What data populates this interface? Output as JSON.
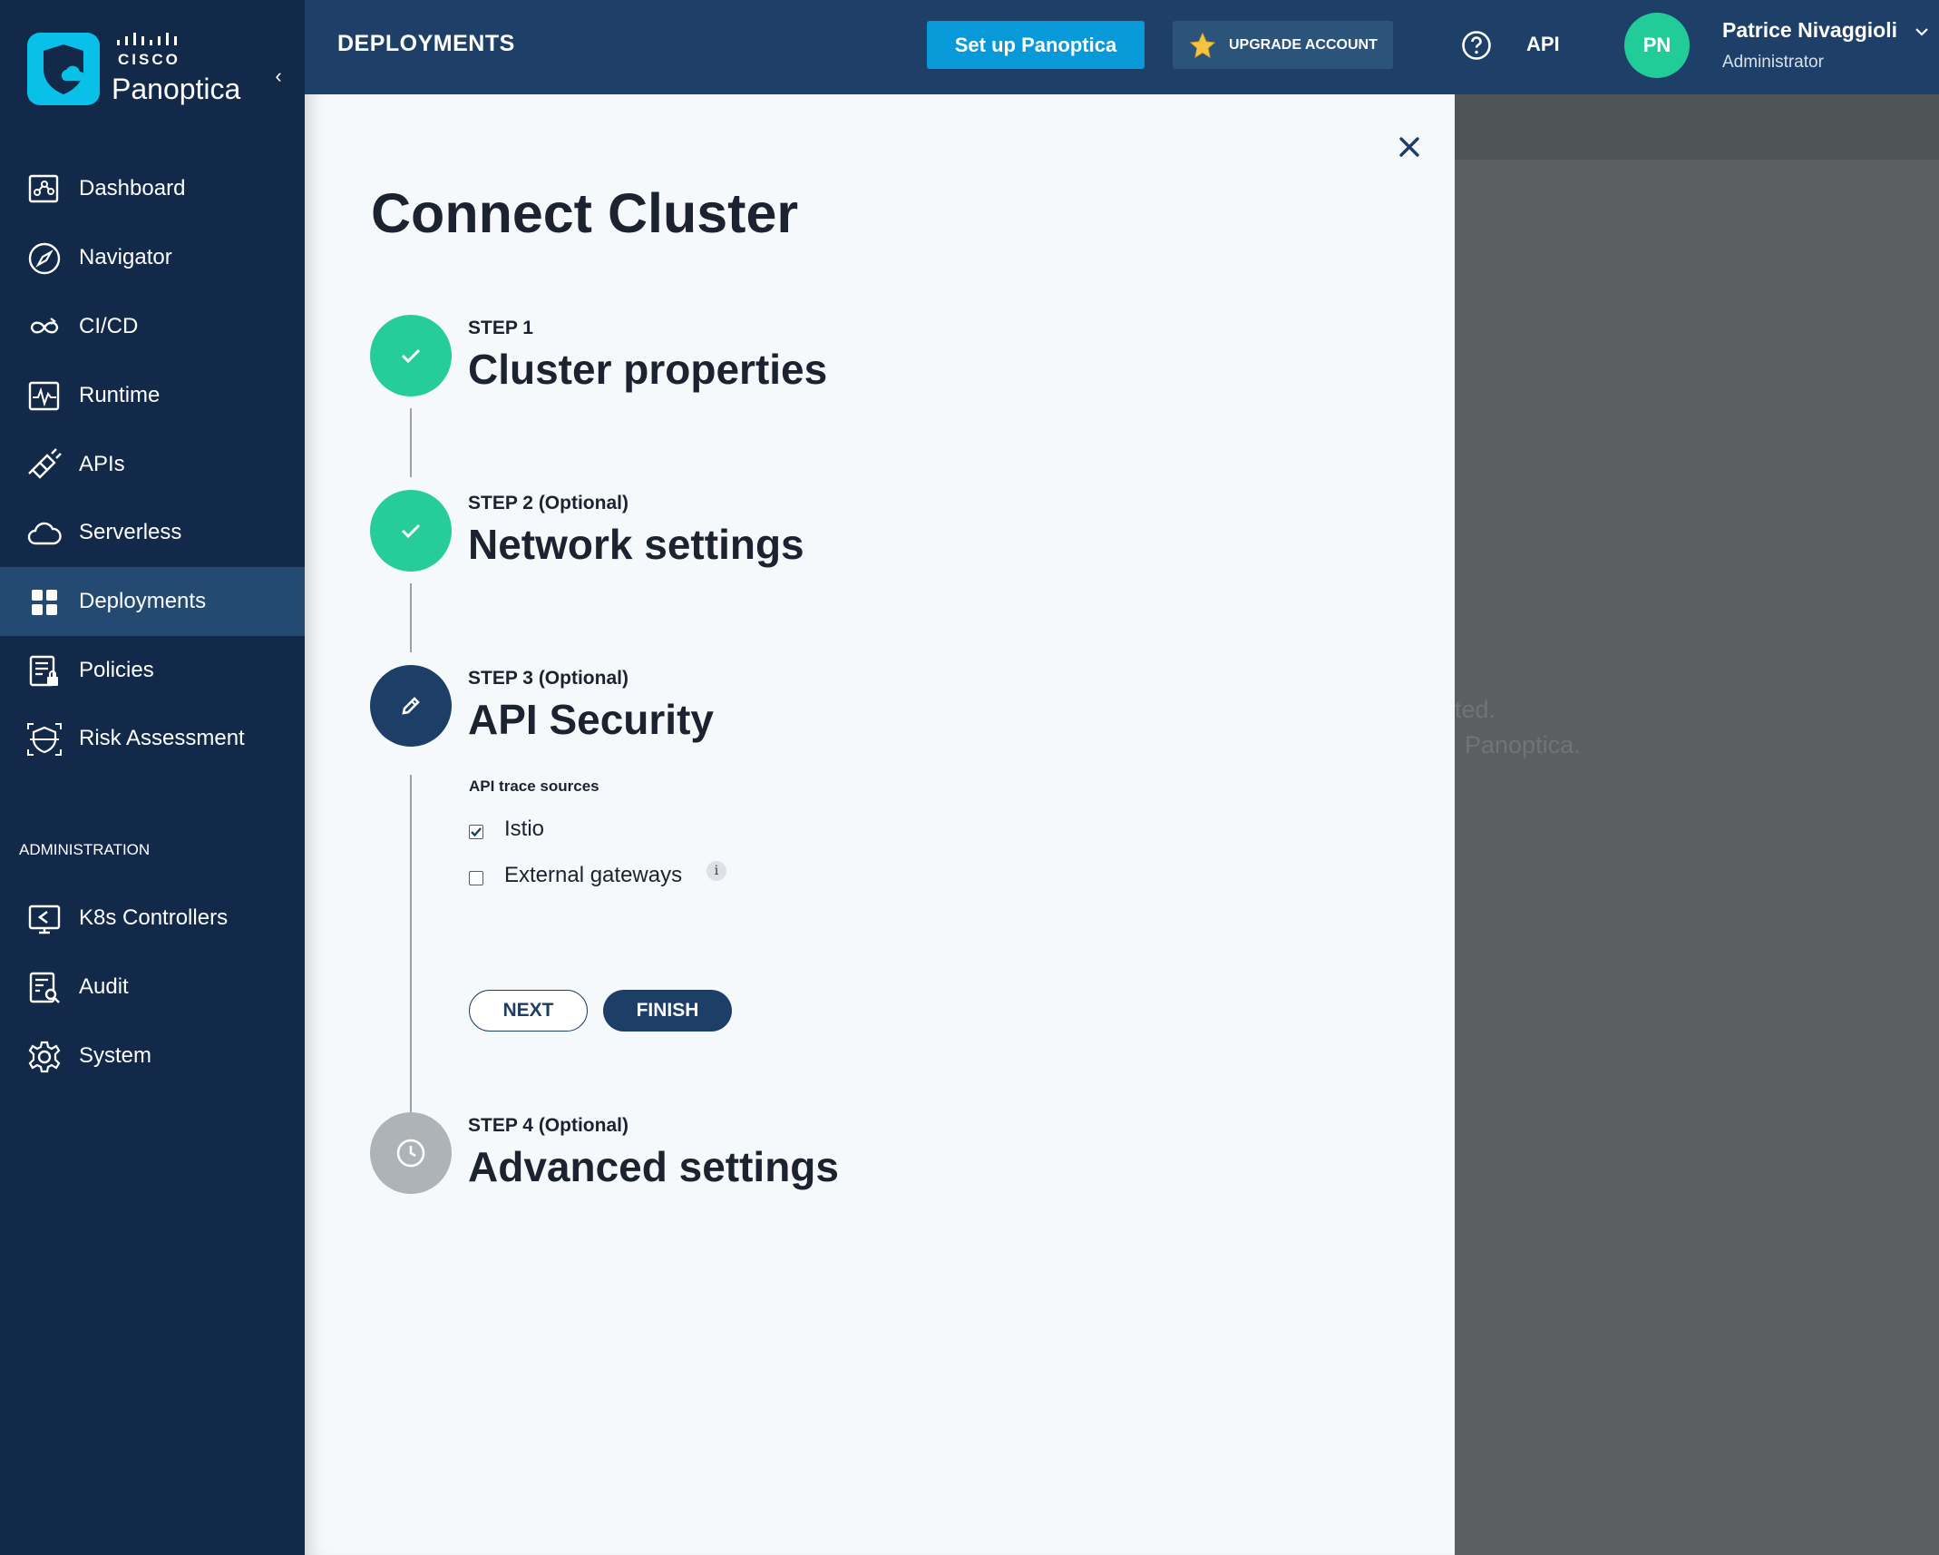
{
  "brand": {
    "company": "CISCO",
    "product": "Panoptica",
    "collapse_icon": "chevron-left-icon"
  },
  "sidebar": {
    "items": [
      {
        "label": "Dashboard",
        "icon": "dashboard-icon"
      },
      {
        "label": "Navigator",
        "icon": "compass-icon"
      },
      {
        "label": "CI/CD",
        "icon": "cicd-loop-icon"
      },
      {
        "label": "Runtime",
        "icon": "runtime-pulse-icon"
      },
      {
        "label": "APIs",
        "icon": "plug-icon"
      },
      {
        "label": "Serverless",
        "icon": "cloud-icon"
      },
      {
        "label": "Deployments",
        "icon": "grid-icon",
        "active": true
      },
      {
        "label": "Policies",
        "icon": "policy-lock-icon"
      },
      {
        "label": "Risk Assessment",
        "icon": "shield-scan-icon"
      }
    ],
    "admin_section_label": "ADMINISTRATION",
    "admin_items": [
      {
        "label": "K8s Controllers",
        "icon": "monitor-controller-icon"
      },
      {
        "label": "Audit",
        "icon": "audit-search-icon"
      },
      {
        "label": "System",
        "icon": "gear-icon"
      }
    ]
  },
  "header": {
    "title": "DEPLOYMENTS",
    "setup_button": "Set up Panoptica",
    "upgrade_button": "UPGRADE ACCOUNT",
    "api_link": "API",
    "user": {
      "initials": "PN",
      "name": "Patrice Nivaggioli",
      "role": "Administrator"
    }
  },
  "background": {
    "text_line1": "ted.",
    "text_line2": "Panoptica."
  },
  "modal": {
    "title": "Connect Cluster",
    "steps": [
      {
        "label": "STEP 1",
        "title": "Cluster properties",
        "status": "done"
      },
      {
        "label": "STEP 2 (Optional)",
        "title": "Network settings",
        "status": "done"
      },
      {
        "label": "STEP 3 (Optional)",
        "title": "API Security",
        "status": "current"
      },
      {
        "label": "STEP 4 (Optional)",
        "title": "Advanced settings",
        "status": "pending"
      }
    ],
    "api_trace_sources_label": "API trace sources",
    "options": [
      {
        "label": "Istio",
        "checked": true
      },
      {
        "label": "External gateways",
        "checked": false
      }
    ],
    "next_button": "NEXT",
    "finish_button": "FINISH"
  },
  "colors": {
    "sidebar_bg": "#12294a",
    "header_bg": "#1e4068",
    "accent_blue": "#089ad8",
    "success_green": "#26cc9a",
    "primary_navy": "#1d3e66"
  }
}
